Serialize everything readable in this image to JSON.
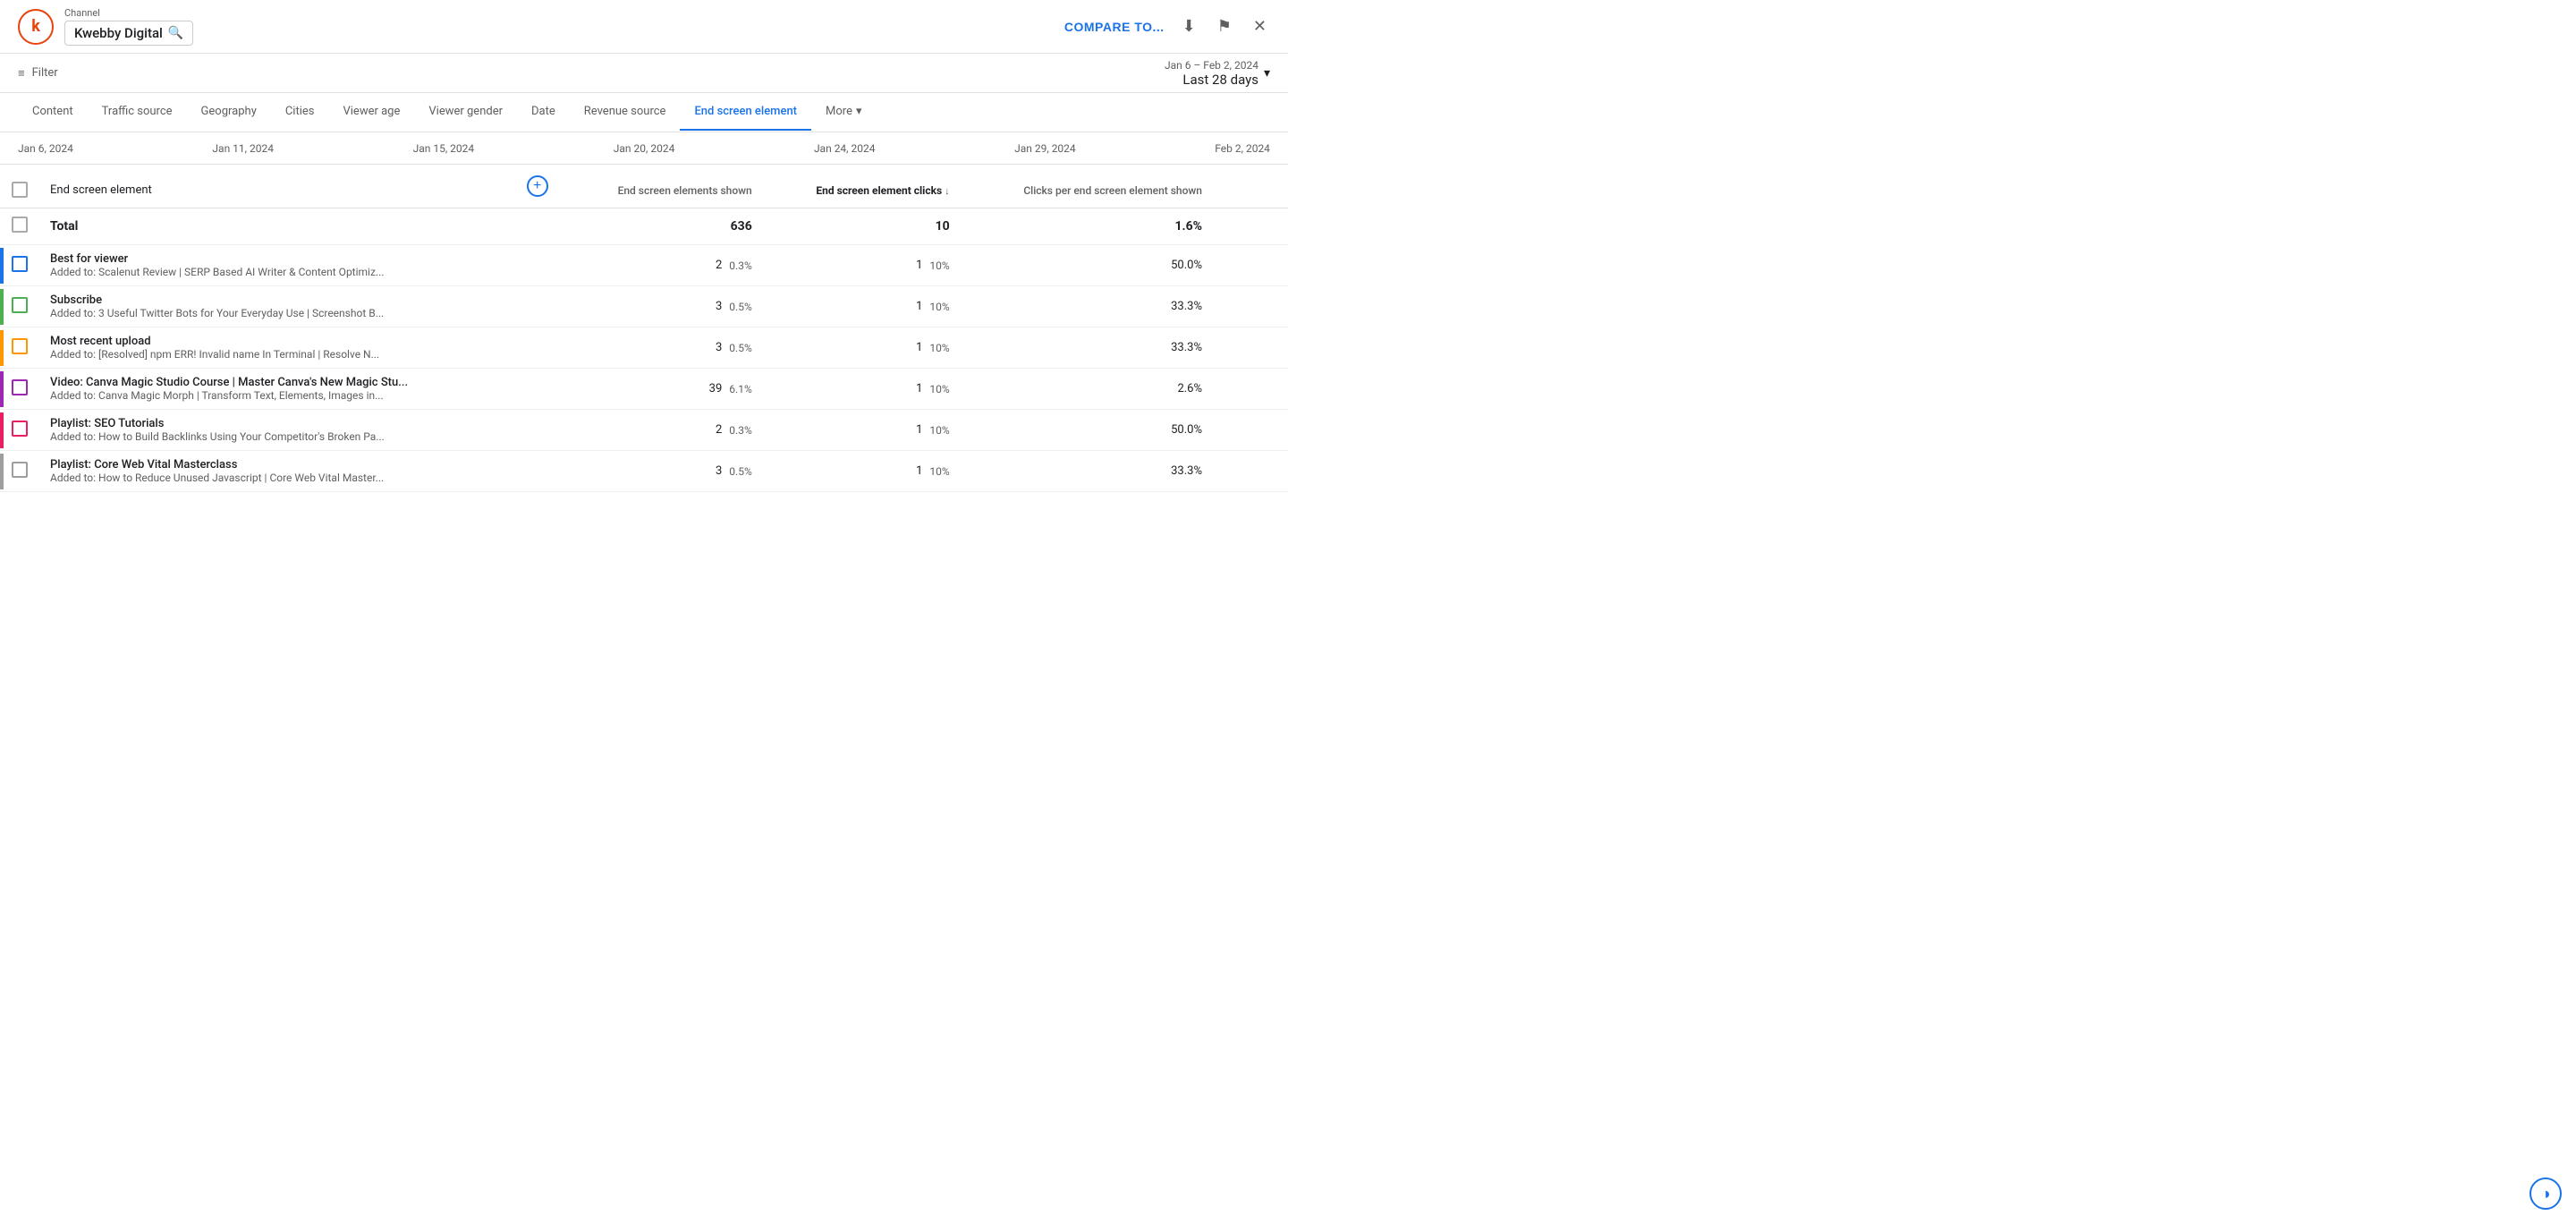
{
  "header": {
    "channel_label": "Channel",
    "channel_name": "Kwebby Digital",
    "compare_label": "COMPARE TO...",
    "download_icon": "↓",
    "flag_icon": "⚑",
    "close_icon": "✕"
  },
  "filter_bar": {
    "filter_label": "Filter",
    "filter_icon": "≡",
    "date_range_sub": "Jan 6 – Feb 2, 2024",
    "date_range_main": "Last 28 days",
    "dropdown_icon": "▾"
  },
  "nav_tabs": [
    {
      "id": "content",
      "label": "Content",
      "active": false
    },
    {
      "id": "traffic_source",
      "label": "Traffic source",
      "active": false
    },
    {
      "id": "geography",
      "label": "Geography",
      "active": false
    },
    {
      "id": "cities",
      "label": "Cities",
      "active": false
    },
    {
      "id": "viewer_age",
      "label": "Viewer age",
      "active": false
    },
    {
      "id": "viewer_gender",
      "label": "Viewer gender",
      "active": false
    },
    {
      "id": "date",
      "label": "Date",
      "active": false
    },
    {
      "id": "revenue_source",
      "label": "Revenue source",
      "active": false
    },
    {
      "id": "end_screen_element",
      "label": "End screen element",
      "active": true
    },
    {
      "id": "more",
      "label": "More",
      "active": false,
      "has_dropdown": true
    }
  ],
  "date_axis": {
    "ticks": [
      "Jan 6, 2024",
      "Jan 11, 2024",
      "Jan 15, 2024",
      "Jan 20, 2024",
      "Jan 24, 2024",
      "Jan 29, 2024",
      "Feb 2, 2024"
    ]
  },
  "table": {
    "col_label": "End screen element",
    "add_col_icon": "+",
    "columns": [
      {
        "id": "elements_shown",
        "label": "End screen elements shown",
        "bold": false
      },
      {
        "id": "element_clicks",
        "label": "End screen element clicks",
        "bold": true,
        "sort_icon": "↓"
      },
      {
        "id": "clicks_per_shown",
        "label": "Clicks per end screen element shown",
        "bold": false
      }
    ],
    "total_row": {
      "label": "Total",
      "elements_shown": "636",
      "element_clicks": "10",
      "clicks_per_shown": "1.6%"
    },
    "rows": [
      {
        "color": "#1a73e8",
        "main_label": "Best for viewer",
        "sub_label": "Added to: Scalenut Review | SERP Based AI Writer & Content Optimiz...",
        "elements_shown": "2",
        "elements_shown_pct": "0.3%",
        "element_clicks": "1",
        "element_clicks_pct": "10%",
        "clicks_per_shown": "50.0%"
      },
      {
        "color": "#4caf50",
        "main_label": "Subscribe",
        "sub_label": "Added to: 3 Useful Twitter Bots for Your Everyday Use | Screenshot B...",
        "elements_shown": "3",
        "elements_shown_pct": "0.5%",
        "element_clicks": "1",
        "element_clicks_pct": "10%",
        "clicks_per_shown": "33.3%"
      },
      {
        "color": "#ff9800",
        "main_label": "Most recent upload",
        "sub_label": "Added to: [Resolved] npm ERR! Invalid name In Terminal | Resolve N...",
        "elements_shown": "3",
        "elements_shown_pct": "0.5%",
        "element_clicks": "1",
        "element_clicks_pct": "10%",
        "clicks_per_shown": "33.3%"
      },
      {
        "color": "#9c27b0",
        "main_label": "Video: Canva Magic Studio Course | Master Canva's New Magic Stu...",
        "sub_label": "Added to: Canva Magic Morph | Transform Text, Elements, Images in...",
        "elements_shown": "39",
        "elements_shown_pct": "6.1%",
        "element_clicks": "1",
        "element_clicks_pct": "10%",
        "clicks_per_shown": "2.6%"
      },
      {
        "color": "#e91e63",
        "main_label": "Playlist: SEO Tutorials",
        "sub_label": "Added to: How to Build Backlinks Using Your Competitor's Broken Pa...",
        "elements_shown": "2",
        "elements_shown_pct": "0.3%",
        "element_clicks": "1",
        "element_clicks_pct": "10%",
        "clicks_per_shown": "50.0%"
      },
      {
        "color": "#9e9e9e",
        "main_label": "Playlist: Core Web Vital Masterclass",
        "sub_label": "Added to: How to Reduce Unused Javascript | Core Web Vital Master...",
        "elements_shown": "3",
        "elements_shown_pct": "0.5%",
        "element_clicks": "1",
        "element_clicks_pct": "10%",
        "clicks_per_shown": "33.3%"
      }
    ]
  }
}
